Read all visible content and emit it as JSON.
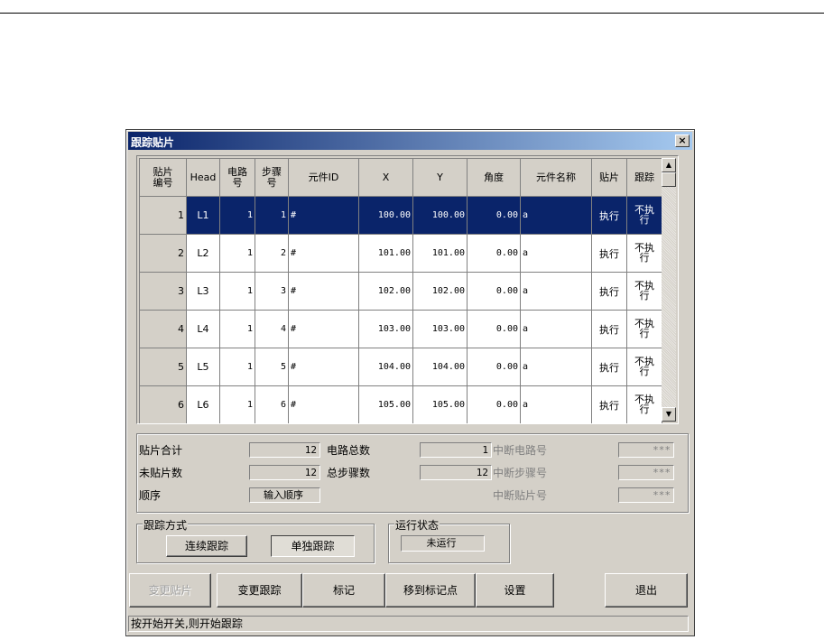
{
  "window": {
    "title": "跟踪贴片",
    "close_glyph": "×"
  },
  "grid": {
    "headers": [
      "贴片\n编号",
      "Head",
      "电路\n号",
      "步骤\n号",
      "元件ID",
      "X",
      "Y",
      "角度",
      "元件名称",
      "贴片",
      "跟踪"
    ],
    "rows": [
      {
        "no": "1",
        "head": "L1",
        "circuit": "1",
        "step": "1",
        "id": "#",
        "x": "100.00",
        "y": "100.00",
        "angle": "0.00",
        "name": "a",
        "place": "执行",
        "track": "不执\n行"
      },
      {
        "no": "2",
        "head": "L2",
        "circuit": "1",
        "step": "2",
        "id": "#",
        "x": "101.00",
        "y": "101.00",
        "angle": "0.00",
        "name": "a",
        "place": "执行",
        "track": "不执\n行"
      },
      {
        "no": "3",
        "head": "L3",
        "circuit": "1",
        "step": "3",
        "id": "#",
        "x": "102.00",
        "y": "102.00",
        "angle": "0.00",
        "name": "a",
        "place": "执行",
        "track": "不执\n行"
      },
      {
        "no": "4",
        "head": "L4",
        "circuit": "1",
        "step": "4",
        "id": "#",
        "x": "103.00",
        "y": "103.00",
        "angle": "0.00",
        "name": "a",
        "place": "执行",
        "track": "不执\n行"
      },
      {
        "no": "5",
        "head": "L5",
        "circuit": "1",
        "step": "5",
        "id": "#",
        "x": "104.00",
        "y": "104.00",
        "angle": "0.00",
        "name": "a",
        "place": "执行",
        "track": "不执\n行"
      },
      {
        "no": "6",
        "head": "L6",
        "circuit": "1",
        "step": "6",
        "id": "#",
        "x": "105.00",
        "y": "105.00",
        "angle": "0.00",
        "name": "a",
        "place": "执行",
        "track": "不执\n行"
      }
    ],
    "scroll_up_glyph": "▲",
    "scroll_down_glyph": "▼"
  },
  "info": {
    "total_label": "贴片合计",
    "total_value": "12",
    "circuits_label": "电路总数",
    "circuits_value": "1",
    "break_circuit_label": "中断电路号",
    "break_circuit_value": "***",
    "unplaced_label": "未贴片数",
    "unplaced_value": "12",
    "steps_label": "总步骤数",
    "steps_value": "12",
    "break_step_label": "中断步骤号",
    "break_step_value": "***",
    "order_label": "顺序",
    "order_value": "输入顺序",
    "break_place_label": "中断贴片号",
    "break_place_value": "***"
  },
  "track_mode": {
    "title": "跟踪方式",
    "continuous": "连续跟踪",
    "single": "单独跟踪"
  },
  "run_state": {
    "title": "运行状态",
    "value": "未运行"
  },
  "buttons": {
    "change_place": "变更贴片",
    "change_track": "变更跟踪",
    "mark": "标记",
    "goto_mark": "移到标记点",
    "settings": "设置",
    "exit": "退出"
  },
  "status": "按开始开关,则开始跟踪"
}
